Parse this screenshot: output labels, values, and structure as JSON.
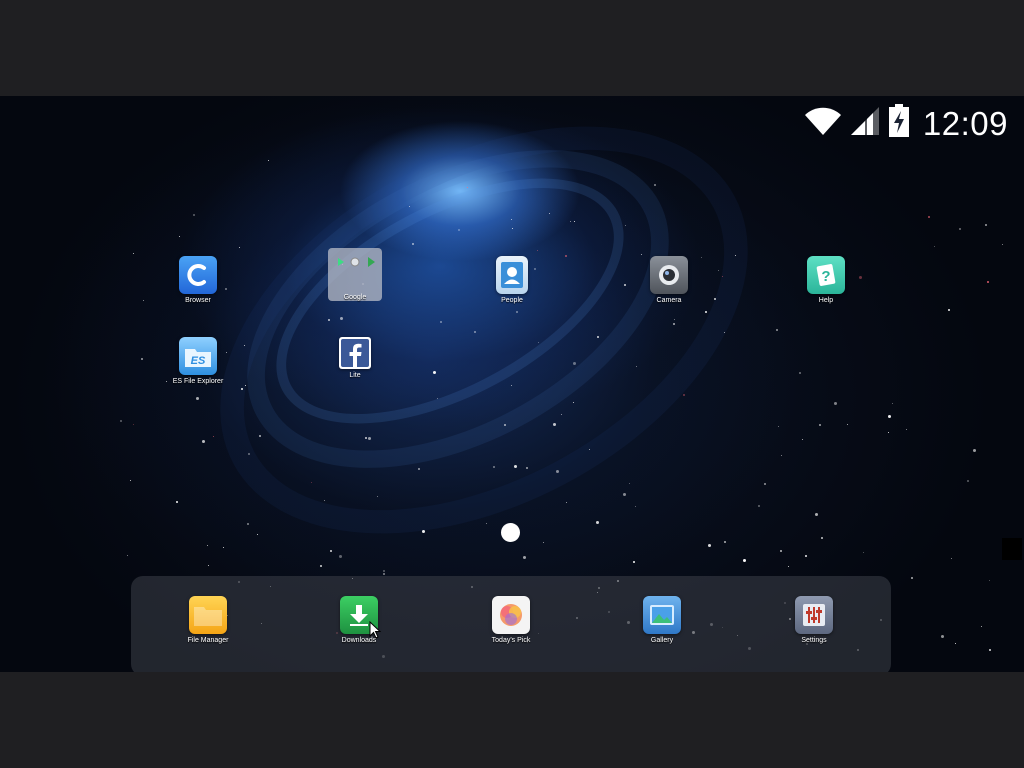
{
  "status_bar": {
    "time": "12:09",
    "wifi_icon": "wifi-icon",
    "signal_icon": "signal-icon",
    "battery_icon": "battery-charging-icon"
  },
  "home": {
    "apps": [
      {
        "label": "Browser",
        "icon": "browser-icon",
        "color": "#2f7fe6"
      },
      {
        "label": "Google",
        "icon": "google-folder-icon",
        "color": "#b9bec8"
      },
      {
        "label": "People",
        "icon": "people-icon",
        "color": "#3a8fd9"
      },
      {
        "label": "Camera",
        "icon": "camera-icon",
        "color": "#5a5f66"
      },
      {
        "label": "Help",
        "icon": "help-icon",
        "color": "#3fcfb4"
      },
      {
        "label": "ES File Explorer",
        "icon": "es-file-explorer-icon",
        "color": "#2e8fe0"
      },
      {
        "label": "Lite",
        "icon": "facebook-lite-icon",
        "color": "#3b5998"
      }
    ],
    "page_indicator": {
      "pages": 1,
      "current": 1
    }
  },
  "dock": {
    "apps": [
      {
        "label": "File Manager",
        "icon": "folder-icon",
        "color": "#f6b21a"
      },
      {
        "label": "Downloads",
        "icon": "download-icon",
        "color": "#29a64a"
      },
      {
        "label": "Today's Pick",
        "icon": "todays-pick-icon",
        "color": "#f27a5e"
      },
      {
        "label": "Gallery",
        "icon": "gallery-icon",
        "color": "#3d8fd6"
      },
      {
        "label": "Settings",
        "icon": "settings-icon",
        "color": "#6d7890"
      }
    ]
  }
}
